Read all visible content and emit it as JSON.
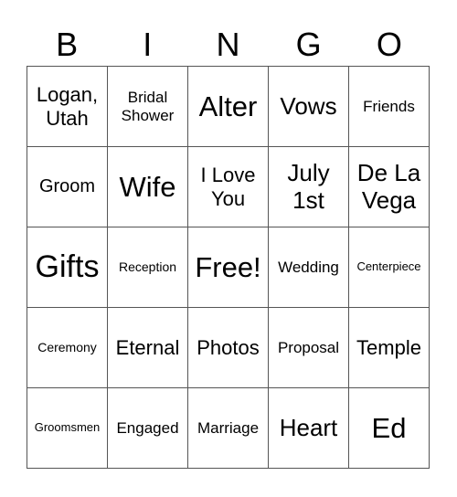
{
  "header": {
    "letters": [
      "B",
      "I",
      "N",
      "G",
      "O"
    ]
  },
  "cells": [
    [
      "Logan, Utah",
      "Bridal Shower",
      "Alter",
      "Vows",
      "Friends"
    ],
    [
      "Groom",
      "Wife",
      "I Love You",
      "July 1st",
      "De La Vega"
    ],
    [
      "Gifts",
      "Reception",
      "Free!",
      "Wedding",
      "Centerpiece"
    ],
    [
      "Ceremony",
      "Eternal",
      "Photos",
      "Proposal",
      "Temple"
    ],
    [
      "Groomsmen",
      "Engaged",
      "Marriage",
      "Heart",
      "Ed"
    ]
  ]
}
